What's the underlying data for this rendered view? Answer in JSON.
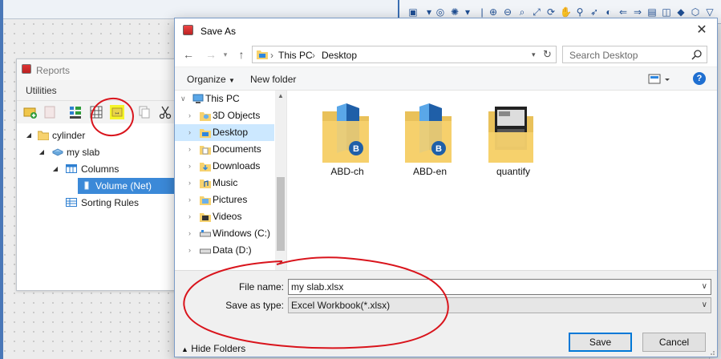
{
  "reports": {
    "title": "Reports",
    "menu": "Utilities",
    "tree": [
      {
        "label": "cylinder",
        "level": 0
      },
      {
        "label": "my slab",
        "level": 1
      },
      {
        "label": "Columns",
        "level": 2
      },
      {
        "label": "Volume (Net)",
        "level": 3
      },
      {
        "label": "Sorting Rules",
        "level": 2
      }
    ]
  },
  "dialog": {
    "title": "Save As",
    "close": "✕",
    "breadcrumb": [
      "This PC",
      "Desktop"
    ],
    "search_placeholder": "Search Desktop",
    "organize": "Organize",
    "new_folder": "New folder",
    "help": "?",
    "nav_items": [
      {
        "label": "This PC",
        "icon": "pc-icon"
      },
      {
        "label": "3D Objects",
        "icon": "folder-3d-icon"
      },
      {
        "label": "Desktop",
        "icon": "desktop-folder-icon"
      },
      {
        "label": "Documents",
        "icon": "documents-folder-icon"
      },
      {
        "label": "Downloads",
        "icon": "downloads-folder-icon"
      },
      {
        "label": "Music",
        "icon": "music-folder-icon"
      },
      {
        "label": "Pictures",
        "icon": "pictures-folder-icon"
      },
      {
        "label": "Videos",
        "icon": "videos-folder-icon"
      },
      {
        "label": "Windows (C:)",
        "icon": "drive-icon"
      },
      {
        "label": "Data (D:)",
        "icon": "drive-icon"
      }
    ],
    "files": [
      {
        "name": "ABD-ch"
      },
      {
        "name": "ABD-en"
      },
      {
        "name": "quantify"
      }
    ],
    "file_name_label": "File name:",
    "file_name_value": "my slab.xlsx",
    "save_type_label": "Save as type:",
    "save_type_value": "Excel Workbook(*.xlsx)",
    "hide_folders": "Hide Folders",
    "save": "Save",
    "cancel": "Cancel"
  },
  "colors": {
    "accent": "#0078d7",
    "selection": "#cce8ff",
    "annotation": "#d9141c",
    "highlight": "#f5f52a"
  }
}
